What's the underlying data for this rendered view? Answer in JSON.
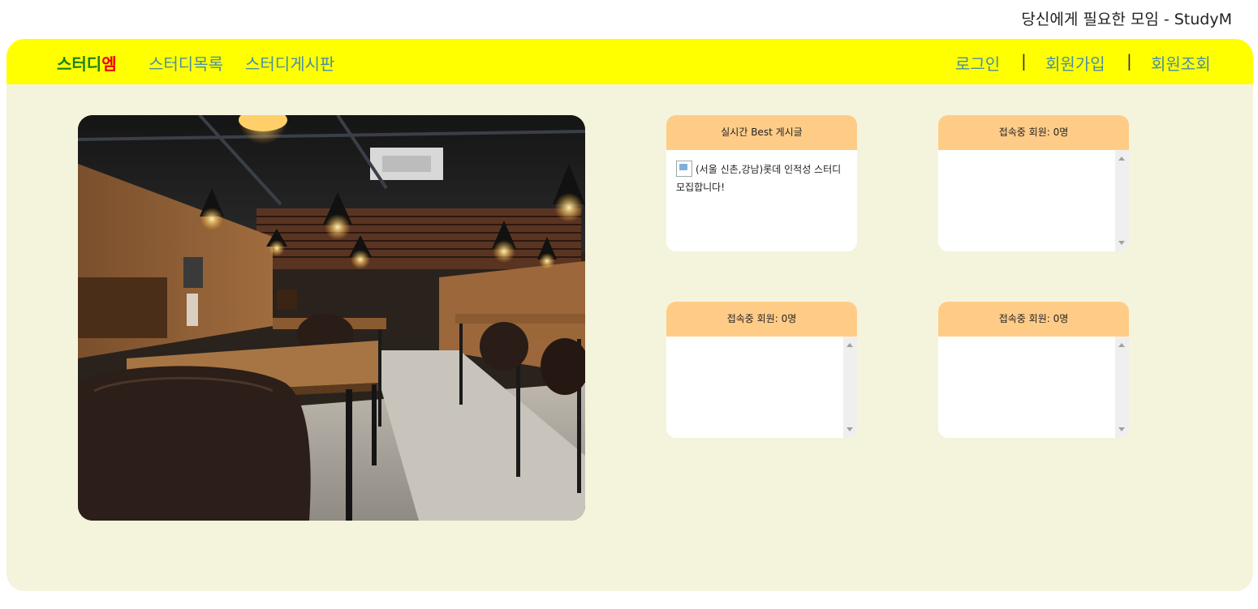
{
  "header": {
    "tagline": "당신에게 필요한 모임 - StudyM"
  },
  "nav": {
    "brand_main": "스터디",
    "brand_accent": "엠",
    "study_list": "스터디목록",
    "study_board": "스터디게시판",
    "login": "로그인",
    "separator": "|",
    "signup": "회원가입",
    "member_lookup": "회원조회"
  },
  "colors": {
    "navbar_bg": "#ffff00",
    "content_bg": "#f4f4dd",
    "brand_green": "#18801e",
    "brand_red": "#ee0000",
    "nav_link": "#4a8fa0",
    "panel_header": "#ffcc88"
  },
  "hero": {
    "image": "study-cafe-interior-photo"
  },
  "panels": {
    "best_posts": {
      "title": "실시간 Best 게시글",
      "items": [
        "(서울 신촌,강남)롯데 인적성 스터디 모집합니다!"
      ]
    },
    "online_1": {
      "title": "접속중 회원: 0명"
    },
    "online_2": {
      "title": "접속중 회원: 0명"
    },
    "online_3": {
      "title": "접속중 회원: 0명"
    }
  }
}
